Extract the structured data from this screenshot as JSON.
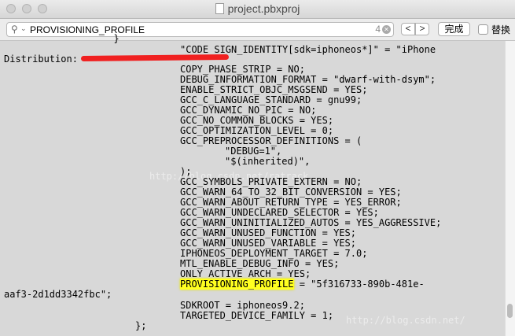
{
  "window": {
    "title": "project.pbxproj"
  },
  "find": {
    "query": "PROVISIONING_PROFILE",
    "count": "4",
    "done_label": "完成",
    "replace_label": "替换"
  },
  "code": {
    "top_partial": "  }",
    "l1": "\"CODE_SIGN_IDENTITY[sdk=iphoneos*]\" = \"iPhone",
    "l2": "Distribution: ",
    "l3": "COPY_PHASE_STRIP = NO;",
    "l4": "DEBUG_INFORMATION_FORMAT = \"dwarf-with-dsym\";",
    "l5": "ENABLE_STRICT_OBJC_MSGSEND = YES;",
    "l6": "GCC_C_LANGUAGE_STANDARD = gnu99;",
    "l7": "GCC_DYNAMIC_NO_PIC = NO;",
    "l8": "GCC_NO_COMMON_BLOCKS = YES;",
    "l9": "GCC_OPTIMIZATION_LEVEL = 0;",
    "l10": "GCC_PREPROCESSOR_DEFINITIONS = (",
    "l11": "\"DEBUG=1\",",
    "l12": "\"$(inherited)\",",
    "l13": ");",
    "l14": "GCC_SYMBOLS_PRIVATE_EXTERN = NO;",
    "l15": "GCC_WARN_64_TO_32_BIT_CONVERSION = YES;",
    "l16": "GCC_WARN_ABOUT_RETURN_TYPE = YES_ERROR;",
    "l17": "GCC_WARN_UNDECLARED_SELECTOR = YES;",
    "l18": "GCC_WARN_UNINITIALIZED_AUTOS = YES_AGGRESSIVE;",
    "l19": "GCC_WARN_UNUSED_FUNCTION = YES;",
    "l20": "GCC_WARN_UNUSED_VARIABLE = YES;",
    "l21": "IPHONEOS_DEPLOYMENT_TARGET = 7.0;",
    "l22": "MTL_ENABLE_DEBUG_INFO = YES;",
    "l23": "ONLY_ACTIVE_ARCH = YES;",
    "l24_key": "PROVISIONING_PROFILE",
    "l24_rest": " = \"5f316733-890b-481e-",
    "l25": "aaf3-2d1dd3342fbc\";",
    "l26": "SDKROOT = iphoneos9.2;",
    "l27": "TARGETED_DEVICE_FAMILY = 1;",
    "l28": "};"
  },
  "watermark": {
    "text1": "http://blog.csdn.net/ratrack",
    "text2": "http://blog.csdn.net/"
  }
}
